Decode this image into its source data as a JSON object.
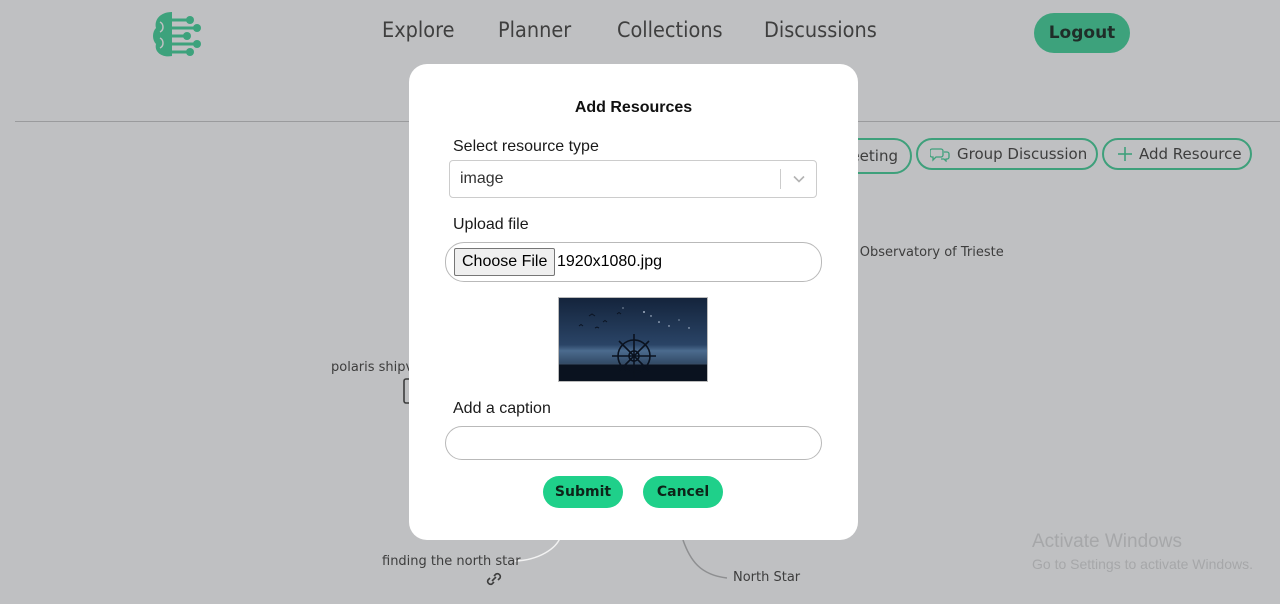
{
  "nav": {
    "items": [
      "Explore",
      "Planner",
      "Collections",
      "Discussions"
    ],
    "logout_label": "Logout"
  },
  "toolbar": {
    "meeting_label": "eeting",
    "group_discussion_label": "Group Discussion",
    "add_resource_label": "Add Resource"
  },
  "canvas": {
    "observatory_label": "l Observatory of Trieste",
    "polaris_label": "polaris shipvi",
    "finding_label": "finding the north star",
    "north_star_label": "North Star"
  },
  "modal": {
    "title": "Add Resources",
    "resource_type_label": "Select resource type",
    "resource_type_value": "image",
    "upload_label": "Upload file",
    "choose_file_label": "Choose File",
    "file_name": "1920x1080.jpg",
    "caption_label": "Add a caption",
    "caption_value": "",
    "submit_label": "Submit",
    "cancel_label": "Cancel"
  },
  "watermark": {
    "title": "Activate Windows",
    "subtitle": "Go to Settings to activate Windows."
  },
  "colors": {
    "accent": "#3ea07b",
    "button_green": "#1fd08a",
    "overlay": "#bfc0c2"
  }
}
